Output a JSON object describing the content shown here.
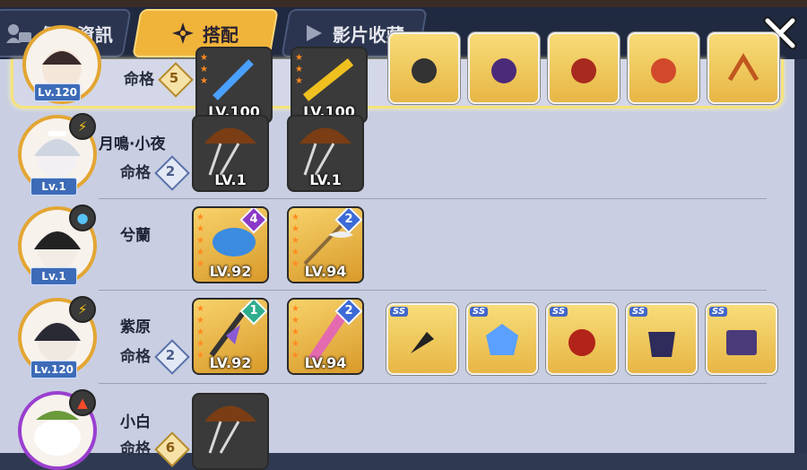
{
  "tabs": [
    {
      "label": "個人資訊",
      "icon": "profile-card-icon"
    },
    {
      "label": "搭配",
      "icon": "shuriken-icon"
    },
    {
      "label": "影片收藏",
      "icon": "play-icon"
    }
  ],
  "fate_label": "命格",
  "ss_label": "SS",
  "characters": [
    {
      "name": "",
      "level": "Lv.120",
      "fate": "5",
      "element": "",
      "weapons": [
        {
          "level": "LV.100"
        },
        {
          "level": "LV.100"
        }
      ],
      "accessories": 5
    },
    {
      "name": "月鳴·小夜",
      "level": "Lv.1",
      "fate": "2",
      "element": "lightning",
      "weapons": [
        {
          "level": "LV.1"
        },
        {
          "level": "LV.1"
        }
      ]
    },
    {
      "name": "兮蘭",
      "level": "Lv.1",
      "fate": "",
      "element": "water",
      "weapons": [
        {
          "level": "LV.92",
          "rank": "4"
        },
        {
          "level": "LV.94",
          "rank": "2"
        }
      ]
    },
    {
      "name": "紫原",
      "level": "Lv.120",
      "fate": "2",
      "element": "lightning",
      "weapons": [
        {
          "level": "LV.92",
          "rank": "1"
        },
        {
          "level": "LV.94",
          "rank": "2"
        }
      ],
      "accessories": 5
    },
    {
      "name": "小白",
      "level": "",
      "fate": "6",
      "element": "fire",
      "weapons": [
        {
          "level": ""
        }
      ]
    }
  ],
  "colors": {
    "tab_active": "#f0b43a",
    "panel": "#c9cee2",
    "header": "#1f2940",
    "level_badge": "#3d6bb7"
  }
}
